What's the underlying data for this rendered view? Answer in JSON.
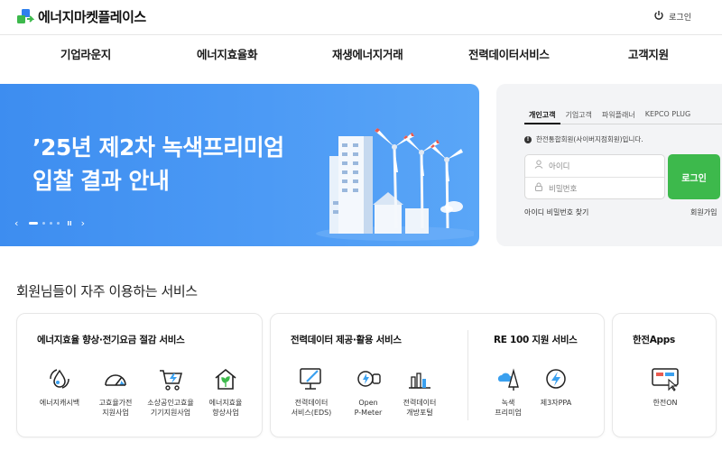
{
  "header": {
    "logo_text": "에너지마켓플레이스",
    "login_label": "로그인"
  },
  "nav": [
    {
      "label": "기업라운지"
    },
    {
      "label": "에너지효율화"
    },
    {
      "label": "재생에너지거래"
    },
    {
      "label": "전력데이터서비스"
    },
    {
      "label": "고객지원"
    }
  ],
  "banner": {
    "title_line1": "’25년 제2차 녹색프리미엄",
    "title_line2": "입찰 결과 안내",
    "pause_glyph": "II"
  },
  "login": {
    "tabs": [
      {
        "label": "개인고객",
        "active": true
      },
      {
        "label": "기업고객",
        "active": false
      },
      {
        "label": "파워플래너",
        "active": false
      },
      {
        "label": "KEPCO PLUG",
        "active": false
      }
    ],
    "notice": "한전통합회원(사이버지점회원)입니다.",
    "id_placeholder": "아이디",
    "pw_placeholder": "비밀번호",
    "submit_label": "로그인",
    "find_label": "아이디 비밀번호 찾기",
    "join_label": "회원가입",
    "accent_color": "#3db94c"
  },
  "services": {
    "section_title": "회원님들이 자주 이용하는 서비스",
    "cards": [
      {
        "title": "에너지효율 향상·전기요금 절감 서비스",
        "items": [
          {
            "line1": "에너지캐시백",
            "line2": "",
            "icon": "water-drop-cycle-icon"
          },
          {
            "line1": "고효율가전",
            "line2": "지원사업",
            "icon": "gauge-icon"
          },
          {
            "line1": "소상공인고효율",
            "line2": "기기지원사업",
            "icon": "bolt-cart-icon"
          },
          {
            "line1": "에너지효율",
            "line2": "향상사업",
            "icon": "eco-house-icon"
          }
        ]
      },
      {
        "title": "전력데이터 제공·활용 서비스",
        "items": [
          {
            "line1": "전력데이터",
            "line2": "서비스(EDS)",
            "icon": "monitor-pen-icon"
          },
          {
            "line1": "Open",
            "line2": "P-Meter",
            "icon": "meter-icon"
          },
          {
            "line1": "전력데이터",
            "line2": "개방포털",
            "icon": "bar-chart-icon"
          }
        ]
      },
      {
        "title": "RE 100 지원 서비스",
        "items": [
          {
            "line1": "녹색",
            "line2": "프리미엄",
            "icon": "cloud-tree-icon"
          },
          {
            "line1": "제3자PPA",
            "line2": "",
            "icon": "bolt-circle-icon"
          }
        ]
      },
      {
        "title": "한전Apps",
        "items": [
          {
            "line1": "한전ON",
            "line2": "",
            "icon": "kepco-on-icon"
          }
        ]
      }
    ]
  }
}
